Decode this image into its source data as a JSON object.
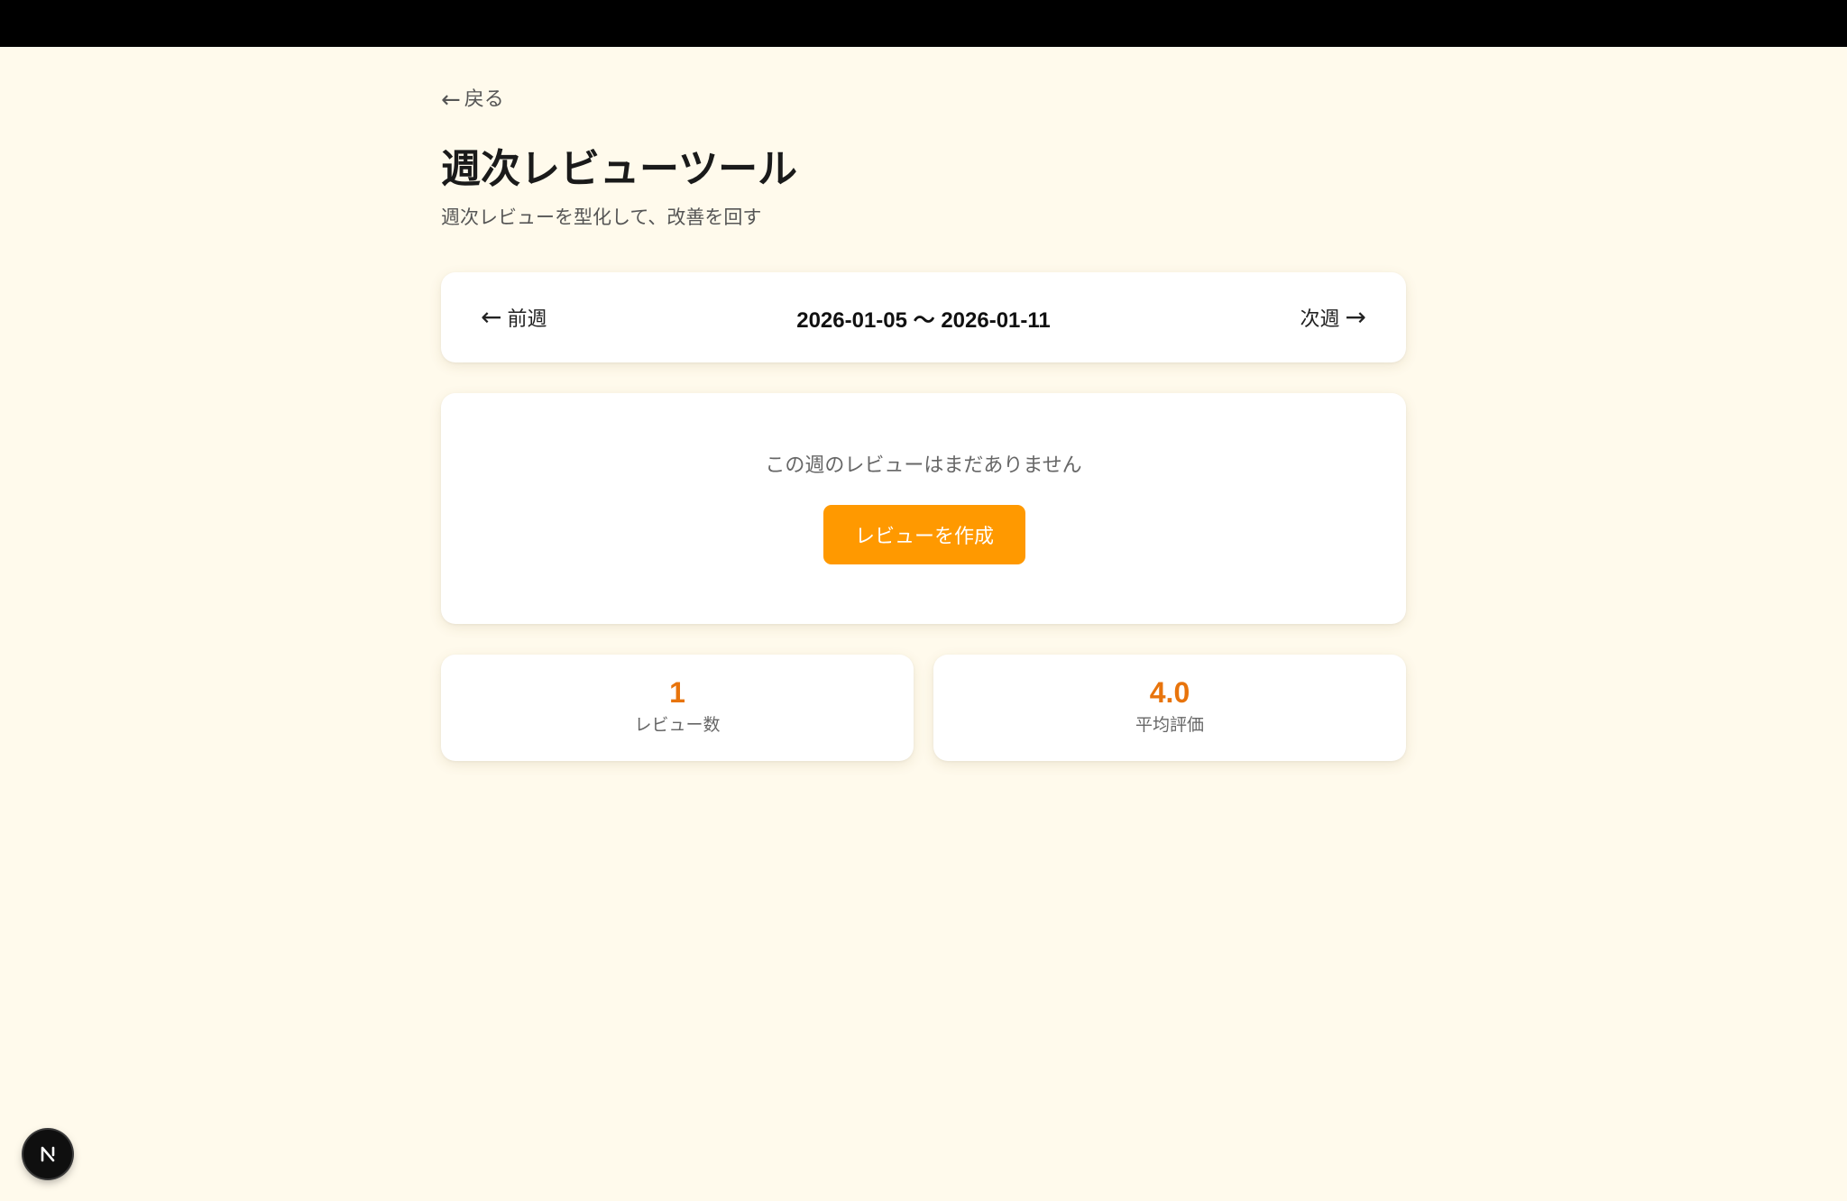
{
  "header": {
    "back_label": "戻る",
    "title": "週次レビューツール",
    "subtitle": "週次レビューを型化して、改善を回す"
  },
  "week_nav": {
    "prev_label": "前週",
    "next_label": "次週",
    "range_label": "2026-01-05 〜 2026-01-11",
    "prev_icon": "arrow-left-icon",
    "next_icon": "arrow-right-icon"
  },
  "empty_state": {
    "message": "この週のレビューはまだありません",
    "create_button_label": "レビューを作成"
  },
  "stats": {
    "review_count": {
      "value": "1",
      "label": "レビュー数"
    },
    "average_rating": {
      "value": "4.0",
      "label": "平均評価"
    }
  },
  "badge": {
    "letter": "N",
    "icon": "nextjs-logo-icon"
  },
  "colors": {
    "background": "#fffaec",
    "accent": "#ff9900",
    "stat_value": "#e8740c",
    "top_bar": "#000000"
  }
}
